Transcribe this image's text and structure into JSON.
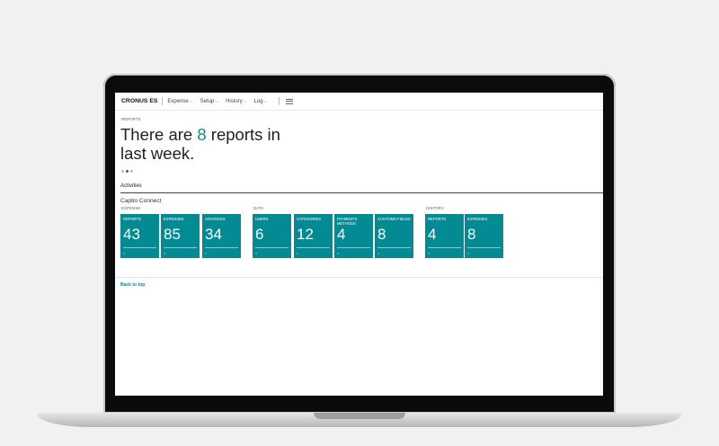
{
  "navbar": {
    "brand": "CRONUS ES",
    "items": [
      {
        "label": "Expense"
      },
      {
        "label": "Setup"
      },
      {
        "label": "History"
      },
      {
        "label": "Log"
      }
    ]
  },
  "caption": "REPORTS",
  "headline": {
    "pre": "There are ",
    "count": "8",
    "post": " reports in last week."
  },
  "activities_label": "Activities",
  "group_title": "Captio Connect",
  "sections": {
    "expense": "EXPENSE",
    "data": "DATA",
    "history": "HISTORY"
  },
  "tiles": [
    {
      "label": "REPORTS",
      "value": "43",
      "foot": ">"
    },
    {
      "label": "EXPENSES",
      "value": "85",
      "foot": ">"
    },
    {
      "label": "ADVANCES",
      "value": "34",
      "foot": ">"
    },
    {
      "label": "USERS",
      "value": "6",
      "foot": ">"
    },
    {
      "label": "CATEGORIES",
      "value": "12",
      "foot": ">"
    },
    {
      "label": "PAYMENTS METHODS",
      "value": "4",
      "foot": ">"
    },
    {
      "label": "CUSTOMS FIELDS",
      "value": "8",
      "foot": ">"
    },
    {
      "label": "REPORTS",
      "value": "4",
      "foot": ">"
    },
    {
      "label": "EXPENSES",
      "value": "8",
      "foot": ">"
    }
  ],
  "back_to_top": "Back to top",
  "colors": {
    "accent": "#00918f",
    "tile": "#048a93"
  },
  "icons": [
    "chevron-down-icon",
    "hamburger-menu-icon"
  ]
}
